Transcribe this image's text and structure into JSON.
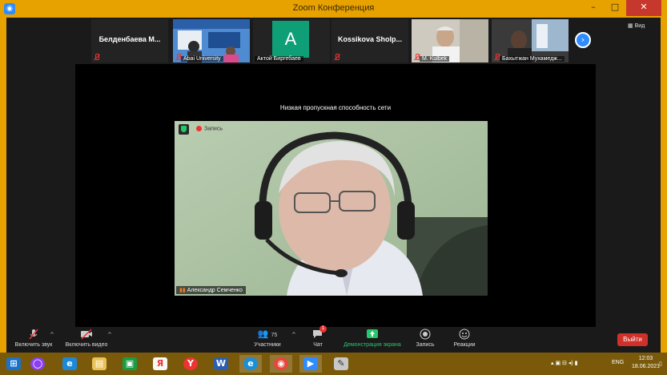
{
  "window": {
    "title": "Zoom Конференция",
    "minimize": "–",
    "maximize": "□",
    "close": "✕"
  },
  "strip": {
    "tiles": [
      {
        "name": "Белденбаева  M...",
        "label": ""
      },
      {
        "name": "",
        "label": "Abai University"
      },
      {
        "name": "",
        "label": "Актой Биргебаев",
        "avatar_letter": "A"
      },
      {
        "name": "Kossikova  Sholp...",
        "label": ""
      },
      {
        "name": "",
        "label": "M. Kulbek"
      },
      {
        "name": "",
        "label": "Бахытжан Мухамедж..."
      }
    ],
    "view_label": "Вид"
  },
  "stage": {
    "notice": "Низкая пропускная способность сети",
    "recording": "Запись",
    "speaker": "Александр Семченко"
  },
  "toolbar": {
    "mute": "Включить звук",
    "video": "Включить видео",
    "participants": "Участники",
    "participants_count": "75",
    "chat": "Чат",
    "chat_badge": "1",
    "share": "Демонстрация экрана",
    "record": "Запись",
    "reactions": "Реакции",
    "leave": "Выйти"
  },
  "taskbar": {
    "apps": [
      "start",
      "alice",
      "ie",
      "explorer",
      "store",
      "yandex",
      "yandex-browser",
      "word",
      "edge",
      "chrome",
      "zoom",
      "paint"
    ],
    "lang": "ENG",
    "time": "12:03",
    "date": "18.06.2021"
  },
  "colors": {
    "accent": "#2d8cff",
    "titlebar": "#e8a200",
    "leave": "#d0302a",
    "share": "#26c76b"
  }
}
